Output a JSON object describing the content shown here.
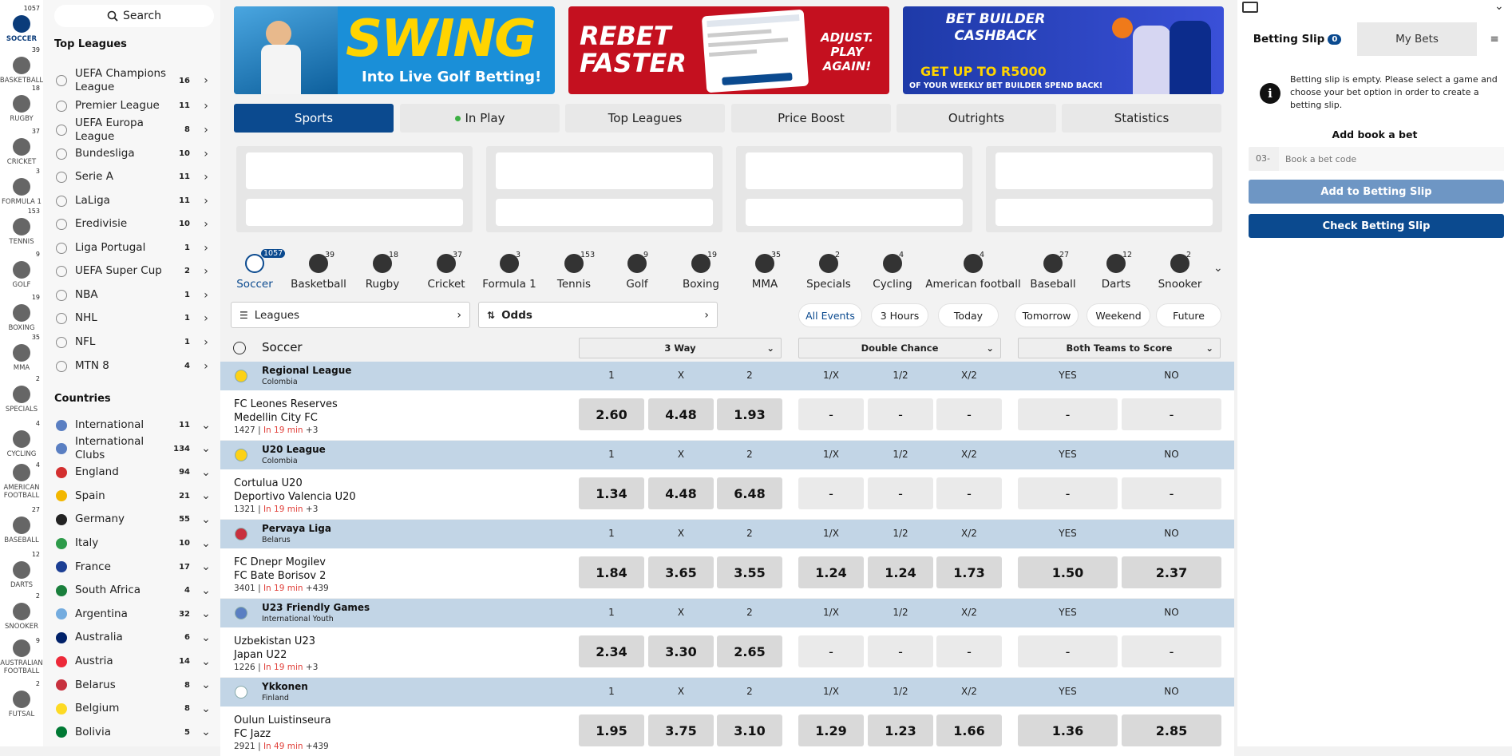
{
  "rail": [
    {
      "label": "SOCCER",
      "count": "1057",
      "icon": "soccer-ball-icon",
      "active": true
    },
    {
      "label": "BASKETBALL",
      "count": "39",
      "icon": "basketball-icon"
    },
    {
      "label": "RUGBY",
      "count": "18",
      "icon": "rugby-ball-icon"
    },
    {
      "label": "CRICKET",
      "count": "37",
      "icon": "cricket-bat-icon"
    },
    {
      "label": "FORMULA 1",
      "count": "3",
      "icon": "checkered-flag-icon"
    },
    {
      "label": "TENNIS",
      "count": "153",
      "icon": "tennis-racket-icon"
    },
    {
      "label": "GOLF",
      "count": "9",
      "icon": "golf-icon"
    },
    {
      "label": "BOXING",
      "count": "19",
      "icon": "boxing-glove-icon"
    },
    {
      "label": "MMA",
      "count": "35",
      "icon": "mma-glove-icon"
    },
    {
      "label": "SPECIALS",
      "count": "2",
      "icon": "specials-icon"
    },
    {
      "label": "CYCLING",
      "count": "4",
      "icon": "bicycle-icon"
    },
    {
      "label": "AMERICAN FOOTBALL",
      "count": "4",
      "icon": "football-helmet-icon"
    },
    {
      "label": "BASEBALL",
      "count": "27",
      "icon": "baseball-icon"
    },
    {
      "label": "DARTS",
      "count": "12",
      "icon": "dartboard-icon"
    },
    {
      "label": "SNOOKER",
      "count": "2",
      "icon": "snooker-icon"
    },
    {
      "label": "AUSTRALIAN FOOTBALL",
      "count": "9",
      "icon": "aussie-rules-icon"
    },
    {
      "label": "FUTSAL",
      "count": "2",
      "icon": "futsal-icon"
    }
  ],
  "search": {
    "label": "Search"
  },
  "top_leagues": {
    "title": "Top Leagues",
    "items": [
      {
        "label": "UEFA Champions League",
        "count": "16"
      },
      {
        "label": "Premier League",
        "count": "11"
      },
      {
        "label": "UEFA Europa League",
        "count": "8"
      },
      {
        "label": "Bundesliga",
        "count": "10"
      },
      {
        "label": "Serie A",
        "count": "11"
      },
      {
        "label": "LaLiga",
        "count": "11"
      },
      {
        "label": "Eredivisie",
        "count": "10"
      },
      {
        "label": "Liga Portugal",
        "count": "1"
      },
      {
        "label": "UEFA Super Cup",
        "count": "2"
      },
      {
        "label": "NBA",
        "count": "1"
      },
      {
        "label": "NHL",
        "count": "1"
      },
      {
        "label": "NFL",
        "count": "1"
      },
      {
        "label": "MTN 8",
        "count": "4"
      }
    ]
  },
  "countries": {
    "title": "Countries",
    "items": [
      {
        "label": "International",
        "count": "11",
        "color": "#5a7fc2"
      },
      {
        "label": "International Clubs",
        "count": "134",
        "color": "#5a7fc2"
      },
      {
        "label": "England",
        "count": "94",
        "color": "#d32f2f"
      },
      {
        "label": "Spain",
        "count": "21",
        "color": "#f3b700"
      },
      {
        "label": "Germany",
        "count": "55",
        "color": "#222222"
      },
      {
        "label": "Italy",
        "count": "10",
        "color": "#2e9b4a"
      },
      {
        "label": "France",
        "count": "17",
        "color": "#1c3f94"
      },
      {
        "label": "South Africa",
        "count": "4",
        "color": "#1a7f3c"
      },
      {
        "label": "Argentina",
        "count": "32",
        "color": "#74acdf"
      },
      {
        "label": "Australia",
        "count": "6",
        "color": "#012169"
      },
      {
        "label": "Austria",
        "count": "14",
        "color": "#ed2939"
      },
      {
        "label": "Belarus",
        "count": "8",
        "color": "#c8313e"
      },
      {
        "label": "Belgium",
        "count": "8",
        "color": "#fdda24"
      },
      {
        "label": "Bolivia",
        "count": "5",
        "color": "#007934"
      }
    ]
  },
  "banners": [
    {
      "headline": "SWING",
      "sub": "Into Live Golf Betting!",
      "bg": "#1a8fd8",
      "accent": "#ffd400"
    },
    {
      "headline": "REBET FASTER",
      "sub": "ADJUST. PLAY AGAIN!",
      "bg": "#c4101f",
      "accent": "#ffffff"
    },
    {
      "headline": "BET BUILDER CASHBACK",
      "sub": "GET UP TO R5000",
      "sub2": "OF YOUR WEEKLY BET BUILDER SPEND BACK!",
      "bg": "#2d3fc9",
      "accent": "#ffd400"
    }
  ],
  "main_tabs": [
    {
      "label": "Sports",
      "active": true
    },
    {
      "label": "In Play",
      "dot": true
    },
    {
      "label": "Top Leagues"
    },
    {
      "label": "Price Boost"
    },
    {
      "label": "Outrights"
    },
    {
      "label": "Statistics"
    }
  ],
  "sports_bar": [
    {
      "label": "Soccer",
      "count": "1057",
      "active": true
    },
    {
      "label": "Basketball",
      "count": "39"
    },
    {
      "label": "Rugby",
      "count": "18"
    },
    {
      "label": "Cricket",
      "count": "37"
    },
    {
      "label": "Formula 1",
      "count": "3"
    },
    {
      "label": "Tennis",
      "count": "153"
    },
    {
      "label": "Golf",
      "count": "9"
    },
    {
      "label": "Boxing",
      "count": "19"
    },
    {
      "label": "MMA",
      "count": "35"
    },
    {
      "label": "Specials",
      "count": "2"
    },
    {
      "label": "Cycling",
      "count": "4"
    },
    {
      "label": "American football",
      "count": "4"
    },
    {
      "label": "Baseball",
      "count": "27"
    },
    {
      "label": "Darts",
      "count": "12"
    },
    {
      "label": "Snooker",
      "count": "2"
    }
  ],
  "filters": {
    "leagues": "Leagues",
    "odds": "Odds"
  },
  "time_filters": [
    {
      "label": "All Events",
      "active": true
    },
    {
      "label": "3 Hours"
    },
    {
      "label": "Today"
    },
    {
      "label": "Tomorrow"
    },
    {
      "label": "Weekend"
    },
    {
      "label": "Future"
    }
  ],
  "market_header": {
    "sport": "Soccer",
    "markets": [
      "3 Way",
      "Double Chance",
      "Both Teams to Score"
    ]
  },
  "col_headers": [
    "1",
    "X",
    "2",
    "1/X",
    "1/2",
    "X/2",
    "YES",
    "NO"
  ],
  "leagues": [
    {
      "name": "Regional League",
      "country": "Colombia",
      "flag": "#fcd116",
      "match": {
        "home": "FC Leones Reserves",
        "away": "Medellin City FC",
        "id": "1427",
        "time": "In 19 min",
        "more": "+3",
        "odds": [
          "2.60",
          "4.48",
          "1.93",
          "-",
          "-",
          "-",
          "-",
          "-"
        ]
      }
    },
    {
      "name": "U20 League",
      "country": "Colombia",
      "flag": "#fcd116",
      "match": {
        "home": "Cortulua U20",
        "away": "Deportivo Valencia U20",
        "id": "1321",
        "time": "In 19 min",
        "more": "+3",
        "odds": [
          "1.34",
          "4.48",
          "6.48",
          "-",
          "-",
          "-",
          "-",
          "-"
        ]
      }
    },
    {
      "name": "Pervaya Liga",
      "country": "Belarus",
      "flag": "#c8313e",
      "match": {
        "home": "FC Dnepr Mogilev",
        "away": "FC Bate Borisov 2",
        "id": "3401",
        "time": "In 19 min",
        "more": "+439",
        "odds": [
          "1.84",
          "3.65",
          "3.55",
          "1.24",
          "1.24",
          "1.73",
          "1.50",
          "2.37"
        ]
      }
    },
    {
      "name": "U23 Friendly Games",
      "country": "International Youth",
      "flag": "#5a7fc2",
      "match": {
        "home": "Uzbekistan U23",
        "away": "Japan U22",
        "id": "1226",
        "time": "In 19 min",
        "more": "+3",
        "odds": [
          "2.34",
          "3.30",
          "2.65",
          "-",
          "-",
          "-",
          "-",
          "-"
        ]
      }
    },
    {
      "name": "Ykkonen",
      "country": "Finland",
      "flag": "#ffffff",
      "match": {
        "home": "Oulun Luistinseura",
        "away": "FC Jazz",
        "id": "2921",
        "time": "In 49 min",
        "more": "+439",
        "odds": [
          "1.95",
          "3.75",
          "3.10",
          "1.29",
          "1.23",
          "1.66",
          "1.36",
          "2.85"
        ]
      }
    }
  ],
  "slip": {
    "tab_slip": "Betting Slip",
    "slip_count": "0",
    "tab_mybets": "My Bets",
    "empty_msg": "Betting slip is empty. Please select a game and choose your bet option in order to create a betting slip.",
    "book_title": "Add book a bet",
    "prefix": "03-",
    "placeholder": "Book a bet code",
    "add_btn": "Add to Betting Slip",
    "check_btn": "Check Betting Slip",
    "add_color": "#6e96c4",
    "check_color": "#0b4a8f"
  }
}
